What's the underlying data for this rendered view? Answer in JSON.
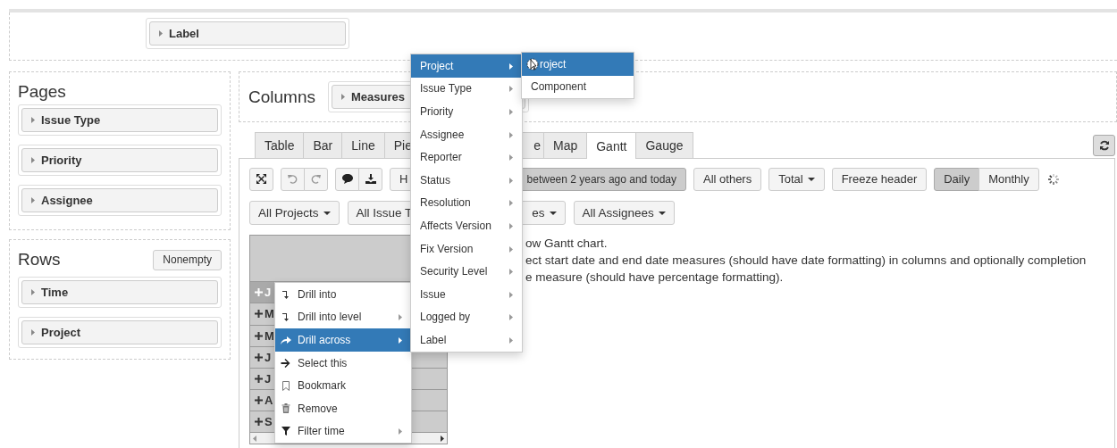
{
  "label_area": {
    "chips": [
      "Label"
    ]
  },
  "pages": {
    "title": "Pages",
    "chips": [
      "Issue Type",
      "Priority",
      "Assignee"
    ]
  },
  "rows_panel": {
    "title": "Rows",
    "button": "Nonempty",
    "chips": [
      "Time",
      "Project"
    ]
  },
  "columns": {
    "title": "Columns",
    "chips": [
      "Measures"
    ]
  },
  "tabs": [
    {
      "label": "Table",
      "selected": false
    },
    {
      "label": "Bar",
      "selected": false
    },
    {
      "label": "Line",
      "selected": false
    },
    {
      "label": "Pie",
      "selected": false
    },
    {
      "label": "e",
      "selected": false
    },
    {
      "label": "Map",
      "selected": false
    },
    {
      "label": "Gantt",
      "selected": true
    },
    {
      "label": "Gauge",
      "selected": false
    }
  ],
  "toolbar": {
    "partial_button": "H",
    "period": {
      "label": "between 2 years ago and today",
      "on": true
    },
    "all_others": "All others",
    "total": "Total",
    "freeze": "Freeze header",
    "granularity": [
      {
        "label": "Daily",
        "selected": true
      },
      {
        "label": "Monthly",
        "selected": false
      }
    ]
  },
  "filters": [
    {
      "label": "All Projects",
      "caret": true
    },
    {
      "label": "All Issue T",
      "caret": false
    },
    {
      "label": "es",
      "caret": true
    },
    {
      "label": "All Assignees",
      "caret": true
    }
  ],
  "table": {
    "rows": [
      {
        "label": "J",
        "selected": true
      },
      {
        "label": "M",
        "selected": false
      },
      {
        "label": "M",
        "selected": false
      },
      {
        "label": "J",
        "selected": false
      },
      {
        "label": "J",
        "selected": false
      },
      {
        "label": "A",
        "selected": false
      },
      {
        "label": "S",
        "selected": false
      }
    ]
  },
  "message": [
    "ow Gantt chart.",
    "ect start date and end date measures (should have date formatting) in columns and optionally completion",
    "e measure (should have percentage formatting)."
  ],
  "context_menu": {
    "items": [
      {
        "label": "Drill into",
        "submenu": false,
        "selected": false
      },
      {
        "label": "Drill into level",
        "submenu": true,
        "selected": false
      },
      {
        "label": "Drill across",
        "submenu": true,
        "selected": true
      },
      {
        "label": "Select this",
        "submenu": false,
        "selected": false
      },
      {
        "label": "Bookmark",
        "submenu": false,
        "selected": false
      },
      {
        "label": "Remove",
        "submenu": false,
        "selected": false
      },
      {
        "label": "Filter time",
        "submenu": true,
        "selected": false
      }
    ]
  },
  "drill_across_menu": {
    "items": [
      {
        "label": "Project",
        "selected": true
      },
      {
        "label": "Issue Type",
        "selected": false
      },
      {
        "label": "Priority",
        "selected": false
      },
      {
        "label": "Assignee",
        "selected": false
      },
      {
        "label": "Reporter",
        "selected": false
      },
      {
        "label": "Status",
        "selected": false
      },
      {
        "label": "Resolution",
        "selected": false
      },
      {
        "label": "Affects Version",
        "selected": false
      },
      {
        "label": "Fix Version",
        "selected": false
      },
      {
        "label": "Security Level",
        "selected": false
      },
      {
        "label": "Issue",
        "selected": false
      },
      {
        "label": "Logged by",
        "selected": false
      },
      {
        "label": "Label",
        "selected": false
      }
    ]
  },
  "level_menu": {
    "items": [
      {
        "label": "roject",
        "selected": true
      },
      {
        "label": "Component",
        "selected": false
      }
    ]
  }
}
